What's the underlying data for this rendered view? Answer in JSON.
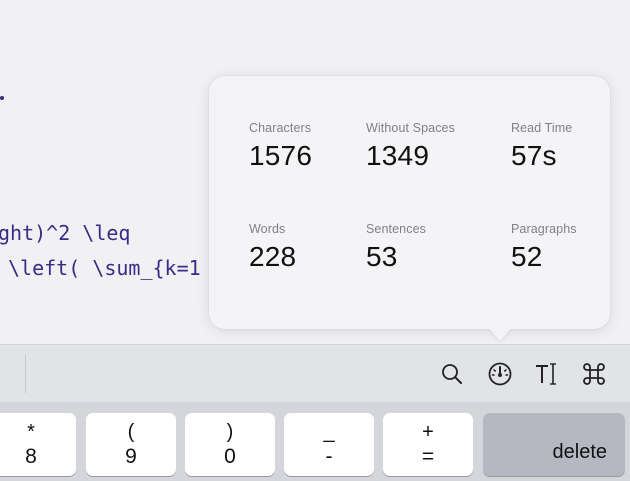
{
  "editor": {
    "lines": [
      "ght)^2 \\leq",
      "\\left( \\sum_{k=1"
    ]
  },
  "stats": {
    "characters": {
      "label": "Characters",
      "value": "1576"
    },
    "without_spaces": {
      "label": "Without Spaces",
      "value": "1349"
    },
    "read_time": {
      "label": "Read Time",
      "value": "57s"
    },
    "words": {
      "label": "Words",
      "value": "228"
    },
    "sentences": {
      "label": "Sentences",
      "value": "53"
    },
    "paragraphs": {
      "label": "Paragraphs",
      "value": "52"
    }
  },
  "toolbar": {
    "icons": [
      "search-icon",
      "gauge-icon",
      "text-format-icon",
      "command-icon"
    ]
  },
  "keyboard": {
    "keys": [
      {
        "top": "*",
        "bottom": "8"
      },
      {
        "top": "(",
        "bottom": "9"
      },
      {
        "top": ")",
        "bottom": "0"
      },
      {
        "top": "_",
        "bottom": "-"
      },
      {
        "top": "+",
        "bottom": "="
      }
    ],
    "delete_label": "delete"
  },
  "colors": {
    "code_text": "#3b2a86",
    "delete_key": "#b5b8c1",
    "toolbar_bg": "#e2e3e7"
  }
}
